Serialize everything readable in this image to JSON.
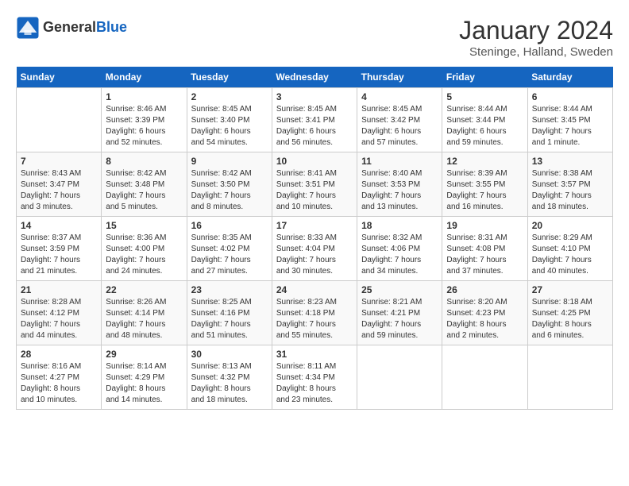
{
  "header": {
    "logo_line1": "General",
    "logo_line2": "Blue",
    "month": "January 2024",
    "location": "Steninge, Halland, Sweden"
  },
  "days_of_week": [
    "Sunday",
    "Monday",
    "Tuesday",
    "Wednesday",
    "Thursday",
    "Friday",
    "Saturday"
  ],
  "weeks": [
    [
      {
        "day": "",
        "info": ""
      },
      {
        "day": "1",
        "info": "Sunrise: 8:46 AM\nSunset: 3:39 PM\nDaylight: 6 hours\nand 52 minutes."
      },
      {
        "day": "2",
        "info": "Sunrise: 8:45 AM\nSunset: 3:40 PM\nDaylight: 6 hours\nand 54 minutes."
      },
      {
        "day": "3",
        "info": "Sunrise: 8:45 AM\nSunset: 3:41 PM\nDaylight: 6 hours\nand 56 minutes."
      },
      {
        "day": "4",
        "info": "Sunrise: 8:45 AM\nSunset: 3:42 PM\nDaylight: 6 hours\nand 57 minutes."
      },
      {
        "day": "5",
        "info": "Sunrise: 8:44 AM\nSunset: 3:44 PM\nDaylight: 6 hours\nand 59 minutes."
      },
      {
        "day": "6",
        "info": "Sunrise: 8:44 AM\nSunset: 3:45 PM\nDaylight: 7 hours\nand 1 minute."
      }
    ],
    [
      {
        "day": "7",
        "info": "Sunrise: 8:43 AM\nSunset: 3:47 PM\nDaylight: 7 hours\nand 3 minutes."
      },
      {
        "day": "8",
        "info": "Sunrise: 8:42 AM\nSunset: 3:48 PM\nDaylight: 7 hours\nand 5 minutes."
      },
      {
        "day": "9",
        "info": "Sunrise: 8:42 AM\nSunset: 3:50 PM\nDaylight: 7 hours\nand 8 minutes."
      },
      {
        "day": "10",
        "info": "Sunrise: 8:41 AM\nSunset: 3:51 PM\nDaylight: 7 hours\nand 10 minutes."
      },
      {
        "day": "11",
        "info": "Sunrise: 8:40 AM\nSunset: 3:53 PM\nDaylight: 7 hours\nand 13 minutes."
      },
      {
        "day": "12",
        "info": "Sunrise: 8:39 AM\nSunset: 3:55 PM\nDaylight: 7 hours\nand 16 minutes."
      },
      {
        "day": "13",
        "info": "Sunrise: 8:38 AM\nSunset: 3:57 PM\nDaylight: 7 hours\nand 18 minutes."
      }
    ],
    [
      {
        "day": "14",
        "info": "Sunrise: 8:37 AM\nSunset: 3:59 PM\nDaylight: 7 hours\nand 21 minutes."
      },
      {
        "day": "15",
        "info": "Sunrise: 8:36 AM\nSunset: 4:00 PM\nDaylight: 7 hours\nand 24 minutes."
      },
      {
        "day": "16",
        "info": "Sunrise: 8:35 AM\nSunset: 4:02 PM\nDaylight: 7 hours\nand 27 minutes."
      },
      {
        "day": "17",
        "info": "Sunrise: 8:33 AM\nSunset: 4:04 PM\nDaylight: 7 hours\nand 30 minutes."
      },
      {
        "day": "18",
        "info": "Sunrise: 8:32 AM\nSunset: 4:06 PM\nDaylight: 7 hours\nand 34 minutes."
      },
      {
        "day": "19",
        "info": "Sunrise: 8:31 AM\nSunset: 4:08 PM\nDaylight: 7 hours\nand 37 minutes."
      },
      {
        "day": "20",
        "info": "Sunrise: 8:29 AM\nSunset: 4:10 PM\nDaylight: 7 hours\nand 40 minutes."
      }
    ],
    [
      {
        "day": "21",
        "info": "Sunrise: 8:28 AM\nSunset: 4:12 PM\nDaylight: 7 hours\nand 44 minutes."
      },
      {
        "day": "22",
        "info": "Sunrise: 8:26 AM\nSunset: 4:14 PM\nDaylight: 7 hours\nand 48 minutes."
      },
      {
        "day": "23",
        "info": "Sunrise: 8:25 AM\nSunset: 4:16 PM\nDaylight: 7 hours\nand 51 minutes."
      },
      {
        "day": "24",
        "info": "Sunrise: 8:23 AM\nSunset: 4:18 PM\nDaylight: 7 hours\nand 55 minutes."
      },
      {
        "day": "25",
        "info": "Sunrise: 8:21 AM\nSunset: 4:21 PM\nDaylight: 7 hours\nand 59 minutes."
      },
      {
        "day": "26",
        "info": "Sunrise: 8:20 AM\nSunset: 4:23 PM\nDaylight: 8 hours\nand 2 minutes."
      },
      {
        "day": "27",
        "info": "Sunrise: 8:18 AM\nSunset: 4:25 PM\nDaylight: 8 hours\nand 6 minutes."
      }
    ],
    [
      {
        "day": "28",
        "info": "Sunrise: 8:16 AM\nSunset: 4:27 PM\nDaylight: 8 hours\nand 10 minutes."
      },
      {
        "day": "29",
        "info": "Sunrise: 8:14 AM\nSunset: 4:29 PM\nDaylight: 8 hours\nand 14 minutes."
      },
      {
        "day": "30",
        "info": "Sunrise: 8:13 AM\nSunset: 4:32 PM\nDaylight: 8 hours\nand 18 minutes."
      },
      {
        "day": "31",
        "info": "Sunrise: 8:11 AM\nSunset: 4:34 PM\nDaylight: 8 hours\nand 23 minutes."
      },
      {
        "day": "",
        "info": ""
      },
      {
        "day": "",
        "info": ""
      },
      {
        "day": "",
        "info": ""
      }
    ]
  ]
}
